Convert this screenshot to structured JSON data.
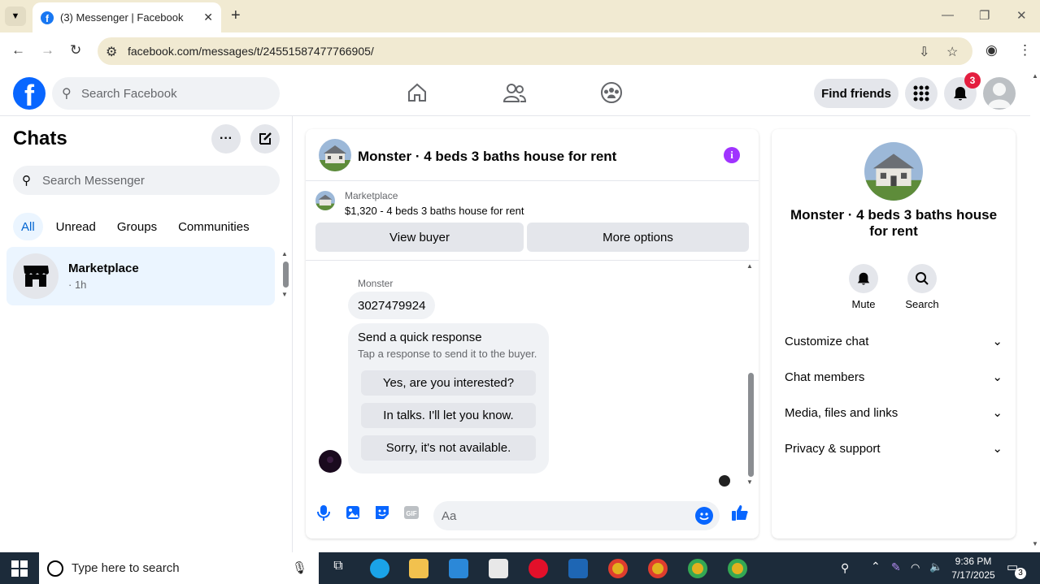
{
  "browser": {
    "tab_title": "(3) Messenger | Facebook",
    "url": "facebook.com/messages/t/24551587477766905/"
  },
  "facebook": {
    "search_placeholder": "Search Facebook",
    "find_friends": "Find friends",
    "notification_count": "3"
  },
  "sidebar": {
    "title": "Chats",
    "search_placeholder": "Search Messenger",
    "filters": [
      "All",
      "Unread",
      "Groups",
      "Communities"
    ],
    "active_filter": "All",
    "chats": [
      {
        "name": "Marketplace",
        "time": "· 1h"
      }
    ]
  },
  "conversation": {
    "title": "Monster · 4 beds 3 baths house for rent",
    "marketplace_label": "Marketplace",
    "listing": "$1,320 - 4 beds 3 baths house for rent",
    "view_buyer": "View buyer",
    "more_options": "More options",
    "sender_name": "Monster",
    "message": "3027479924",
    "quick_title": "Send a quick response",
    "quick_sub": "Tap a response to send it to the buyer.",
    "quick_responses": [
      "Yes, are you interested?",
      "In talks. I'll let you know.",
      "Sorry, it's not available."
    ],
    "input_placeholder": "Aa"
  },
  "details": {
    "title": "Monster · 4 beds 3 baths house for rent",
    "actions": [
      "Mute",
      "Search"
    ],
    "sections": [
      "Customize chat",
      "Chat members",
      "Media, files and links",
      "Privacy & support"
    ]
  },
  "taskbar": {
    "search_placeholder": "Type here to search",
    "time": "9:36 PM",
    "date": "7/17/2025",
    "notif_count": "3"
  },
  "colors": {
    "fb_blue": "#0866ff",
    "active_bg": "#ebf5ff",
    "notify_red": "#e41e3f",
    "info_purple": "#a033ff"
  }
}
